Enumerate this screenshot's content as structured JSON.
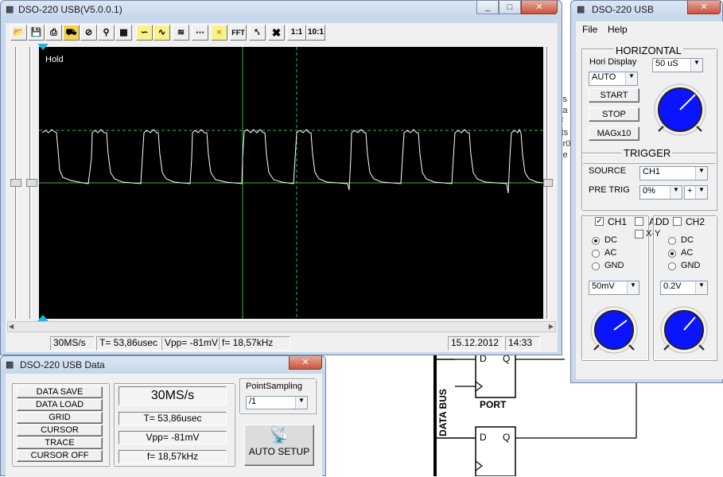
{
  "desktop": {
    "schematic": {
      "data_bus_label": "DATA BUS",
      "port_label": "PORT",
      "ff1": {
        "d": "D",
        "q": "Q"
      },
      "ff2": {
        "d": "D",
        "q": "Q"
      }
    },
    "bg_text": [
      "ks",
      "ita",
      "F",
      "rts",
      "cr0",
      "se"
    ]
  },
  "scope_window": {
    "title": "DSO-220 USB(V5.0.0.1)",
    "toolbar": {
      "buttons": [
        "open-icon",
        "save-icon",
        "print-icon",
        "truck-icon",
        "stop-icon",
        "zoom-icon",
        "grid-icon",
        "wave-icon",
        "wave-icon-2",
        "wave-icon-3",
        "dots-icon",
        "cursor-x-icon",
        "fft-icon",
        "ramp-icon",
        "close-x-icon"
      ],
      "fft_label": "FFT",
      "scale_1_1": "1:1",
      "scale_10_1": "10:1"
    },
    "screen": {
      "hold_label": "Hold"
    },
    "status": {
      "rate": "30MS/s",
      "period": "T= 53,86usec",
      "vpp": "Vpp= -81mV",
      "freq": "f= 18,57kHz",
      "date": "15.12.2012",
      "time": "14:33"
    }
  },
  "control_window": {
    "title": "DSO-220 USB",
    "menu": [
      "File",
      "Help"
    ],
    "horizontal": {
      "heading": "HORIZONTAL",
      "hori_display_label": "Hori Display",
      "timebase": "50 uS",
      "mode": "AUTO",
      "start": "START",
      "stop": "STOP",
      "mag": "MAGx10"
    },
    "trigger": {
      "heading": "TRIGGER",
      "source_label": "SOURCE",
      "source": "CH1",
      "pretrig_label": "PRE TRIG",
      "pretrig": "0%",
      "slope": "+"
    },
    "channels": {
      "ch1": "CH1",
      "add": "ADD",
      "ch2": "CH2",
      "xy": "X-Y",
      "ch1_coupling": [
        "DC",
        "AC",
        "GND"
      ],
      "ch2_coupling": [
        "DC",
        "AC",
        "GND"
      ],
      "ch1_volts": "50mV",
      "ch2_volts": "0.2V"
    }
  },
  "data_window": {
    "title": "DSO-220 USB Data",
    "buttons": [
      "DATA SAVE",
      "DATA LOAD",
      "GRID",
      "CURSOR",
      "TRACE",
      "CURSOR OFF"
    ],
    "rate": "30MS/s",
    "period": "T= 53,86usec",
    "vpp": "Vpp= -81mV",
    "freq": "f= 18,57kHz",
    "point_sampling_label": "PointSampling",
    "point_sampling": "/1",
    "auto_setup": "AUTO SETUP"
  },
  "colors": {
    "trace": "#ffffff",
    "grid": "#33cc33",
    "knob": "#0a14ff",
    "screen": "#000000"
  }
}
